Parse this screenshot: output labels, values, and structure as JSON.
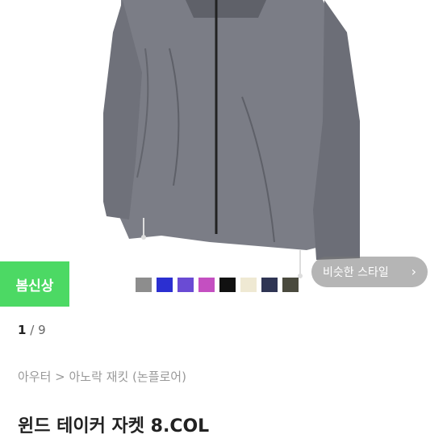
{
  "badge_label": "봄신상",
  "similar_style_label": "비슷한 스타일",
  "similar_chevron": "›",
  "swatches": [
    "#8d8d8d",
    "#2b2fd1",
    "#6a4bd4",
    "#c44fc1",
    "#111111",
    "#efe9d3",
    "#2f3553",
    "#4a4a3e"
  ],
  "pager": {
    "current": "1",
    "separator": "/",
    "total": "9"
  },
  "breadcrumb": "아우터 > 아노락 재킷 (논플로어)",
  "product_title": "윈드 테이커 자켓 8.COL"
}
